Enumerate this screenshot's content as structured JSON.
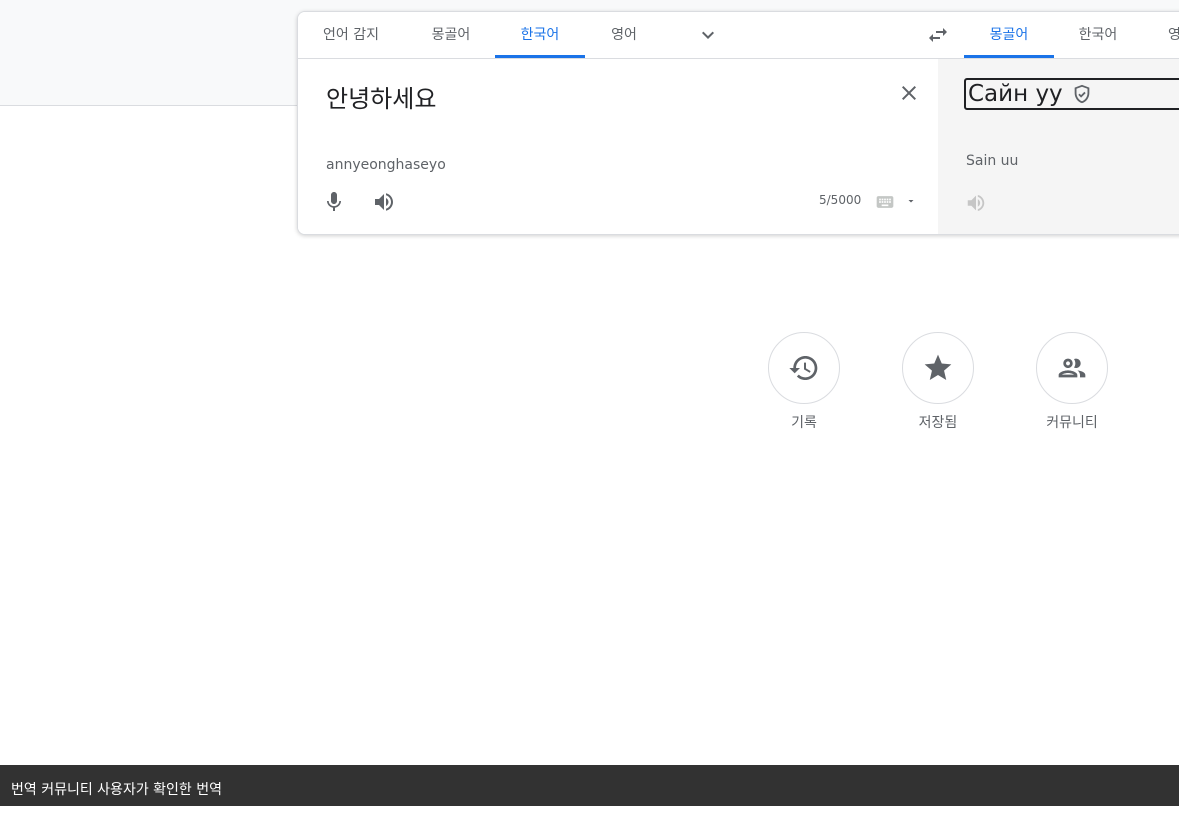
{
  "source_tabs": [
    {
      "label": "언어 감지",
      "active": false
    },
    {
      "label": "몽골어",
      "active": false
    },
    {
      "label": "한국어",
      "active": true
    },
    {
      "label": "영어",
      "active": false
    }
  ],
  "target_tabs": [
    {
      "label": "몽골어",
      "active": true
    },
    {
      "label": "한국어",
      "active": false
    },
    {
      "label": "영어",
      "active": false
    }
  ],
  "source": {
    "text": "안녕하세요",
    "transliteration": "annyeonghaseyo",
    "char_count": "5/5000"
  },
  "target": {
    "text": "Сайн уу",
    "transliteration": "Sain uu"
  },
  "actions": [
    {
      "label": "기록",
      "icon": "history-icon"
    },
    {
      "label": "저장됨",
      "icon": "star-icon"
    },
    {
      "label": "커뮤니티",
      "icon": "community-icon"
    }
  ],
  "snackbar": {
    "text": "번역 커뮤니티 사용자가 확인한 번역"
  },
  "colors": {
    "accent": "#1a73e8",
    "snackbar_bg": "#323232"
  }
}
